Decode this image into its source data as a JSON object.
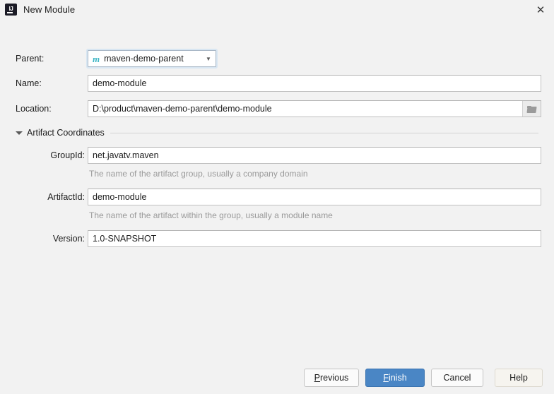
{
  "window": {
    "title": "New Module",
    "app_icon": "intellij-idea-icon",
    "close_icon": "close-icon"
  },
  "form": {
    "parent": {
      "label": "Parent:",
      "value": "maven-demo-parent",
      "icon": "maven-icon",
      "arrow_icon": "chevron-down-icon"
    },
    "name": {
      "label": "Name:",
      "value": "demo-module"
    },
    "location": {
      "label": "Location:",
      "value": "D:\\product\\maven-demo-parent\\demo-module",
      "browse_icon": "folder-icon"
    },
    "artifact_coordinates": {
      "label": "Artifact Coordinates",
      "expanded": true,
      "toggle_icon": "triangle-down-icon",
      "group_id": {
        "label": "GroupId:",
        "value": "net.javatv.maven",
        "hint": "The name of the artifact group, usually a company domain"
      },
      "artifact_id": {
        "label": "ArtifactId:",
        "value": "demo-module",
        "hint": "The name of the artifact within the group, usually a module name"
      },
      "version": {
        "label": "Version:",
        "value": "1.0-SNAPSHOT"
      }
    }
  },
  "buttons": {
    "previous": {
      "label_mnemonic": "P",
      "label_rest": "revious"
    },
    "finish": {
      "label_mnemonic": "F",
      "label_rest": "inish"
    },
    "cancel": {
      "label": "Cancel"
    },
    "help": {
      "label": "Help"
    }
  },
  "colors": {
    "background": "#f2f2f2",
    "default_button": "#4a86c5",
    "maven_icon": "#3cb5c4",
    "focus_ring": "#d8e6f2",
    "hint_text": "#9a9a9a"
  }
}
